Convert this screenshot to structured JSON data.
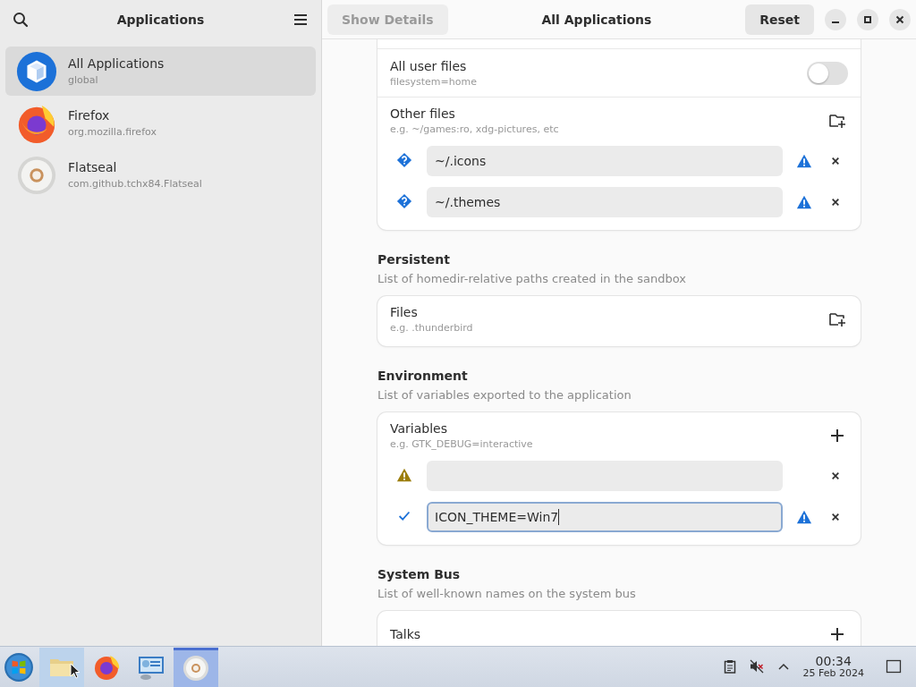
{
  "sidebar": {
    "title": "Applications",
    "items": [
      {
        "name": "All Applications",
        "id": "global",
        "selected": true
      },
      {
        "name": "Firefox",
        "id": "org.mozilla.firefox",
        "selected": false
      },
      {
        "name": "Flatseal",
        "id": "com.github.tchx84.Flatseal",
        "selected": false
      }
    ]
  },
  "header": {
    "show_details": {
      "label": "Show Details",
      "disabled": true
    },
    "title": "All Applications",
    "reset": {
      "label": "Reset",
      "disabled": false
    }
  },
  "sections": [
    {
      "continued": true,
      "rows": [
        {
          "kind": "toggle",
          "title": "All user files",
          "hint": "filesystem=home",
          "on": false
        },
        {
          "kind": "folderlist",
          "title": "Other files",
          "hint": "e.g. ~/games:ro, xdg-pictures, etc",
          "entries": [
            {
              "kind": "unknown",
              "value": "~/.icons",
              "focused": false,
              "warning": true
            },
            {
              "kind": "unknown",
              "value": "~/.themes",
              "focused": false,
              "warning": true
            }
          ]
        }
      ]
    },
    {
      "continued": false,
      "heading": "Persistent",
      "subtitle": "List of homedir-relative paths created in the sandbox",
      "rows": [
        {
          "kind": "folderlist",
          "title": "Files",
          "hint": "e.g. .thunderbird",
          "entries": []
        }
      ]
    },
    {
      "continued": false,
      "heading": "Environment",
      "subtitle": "List of variables exported to the application",
      "rows": [
        {
          "kind": "pluslist",
          "title": "Variables",
          "hint": "e.g. GTK_DEBUG=interactive",
          "entries": [
            {
              "kind": "invalid",
              "focused": false,
              "warning": false
            },
            {
              "kind": "valid",
              "value": "ICON_THEME=Win7",
              "focused": true,
              "warning": true
            }
          ]
        }
      ]
    },
    {
      "continued": false,
      "heading": "System Bus",
      "subtitle": "List of well-known names on the system bus",
      "rows": [
        {
          "kind": "pluslist",
          "title": "Talks",
          "entries": []
        }
      ]
    }
  ],
  "taskbar": {
    "apps": [
      {
        "selected": false,
        "hovered": true
      },
      {
        "selected": false,
        "hovered": false
      },
      {
        "selected": false,
        "hovered": false
      },
      {
        "selected": true,
        "hovered": false
      }
    ],
    "time": "00:34",
    "date": "25 Feb 2024"
  }
}
